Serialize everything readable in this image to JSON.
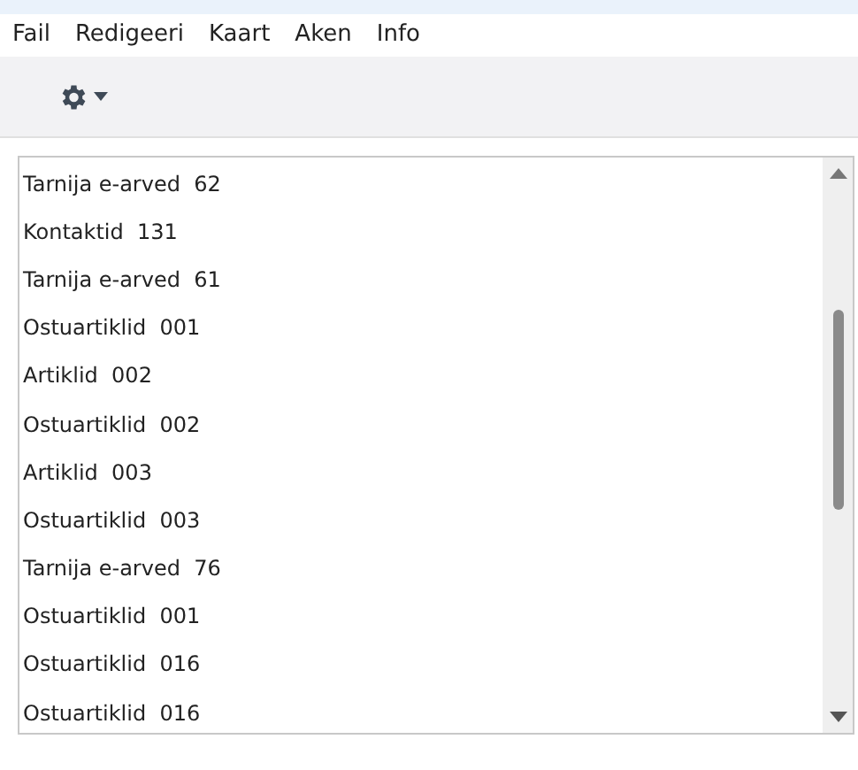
{
  "menu": [
    "Fail",
    "Redigeeri",
    "Kaart",
    "Aken",
    "Info"
  ],
  "list": {
    "items": [
      "Tarnija e-arved  62",
      "Kontaktid  131",
      "Tarnija e-arved  61",
      "Ostuartiklid  001",
      "Artiklid  002",
      "Ostuartiklid  002",
      "Artiklid  003",
      "Ostuartiklid  003",
      "Tarnija e-arved  76",
      "Ostuartiklid  001",
      "Ostuartiklid  016",
      "Ostuartiklid  016"
    ]
  }
}
